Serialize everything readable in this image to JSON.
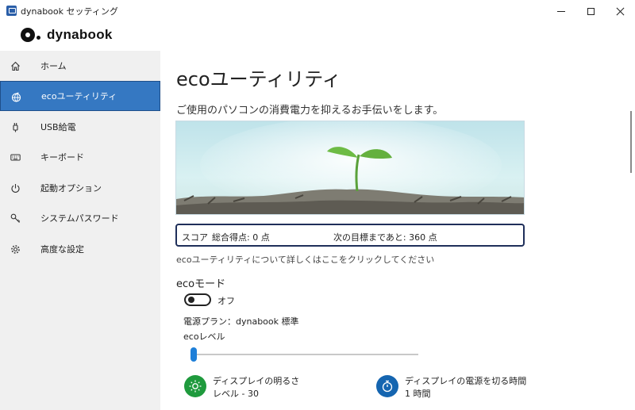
{
  "window": {
    "title": "dynabook セッティング"
  },
  "brand": {
    "name": "dynabook"
  },
  "sidebar": {
    "items": [
      {
        "label": "ホーム",
        "icon": "home-icon"
      },
      {
        "label": "ecoユーティリティ",
        "icon": "eco-globe-icon",
        "active": true
      },
      {
        "label": "USB給電",
        "icon": "usb-plug-icon"
      },
      {
        "label": "キーボード",
        "icon": "keyboard-icon"
      },
      {
        "label": "起動オプション",
        "icon": "power-icon"
      },
      {
        "label": "システムパスワード",
        "icon": "key-icon"
      },
      {
        "label": "高度な設定",
        "icon": "gear-icon"
      }
    ]
  },
  "main": {
    "title": "ecoユーティリティ",
    "description": "ご使用のパソコンの消費電力を抑えるお手伝いをします。",
    "score": {
      "label": "スコア",
      "total": "総合得点: 0 点",
      "next": "次の目標まであと: 360 点"
    },
    "link_text": "ecoユーティリティについて詳しくはここをクリックしてください",
    "eco_mode": {
      "title": "ecoモード",
      "toggle_state": "オフ",
      "power_plan": "電源プラン：dynabook 標準",
      "level_label": "ecoレベル",
      "level_value": 0
    },
    "stats": {
      "brightness_label": "ディスプレイの明るさ",
      "brightness_value": "レベル - 30",
      "display_off_label": "ディスプレイの電源を切る時間",
      "display_off_value": "1 時間"
    }
  },
  "colors": {
    "accent": "#3578c2",
    "slider": "#1e7fd8",
    "brightness_icon": "#1f9a3d",
    "timer_icon": "#1565b0",
    "score_border": "#1f2f5a"
  }
}
